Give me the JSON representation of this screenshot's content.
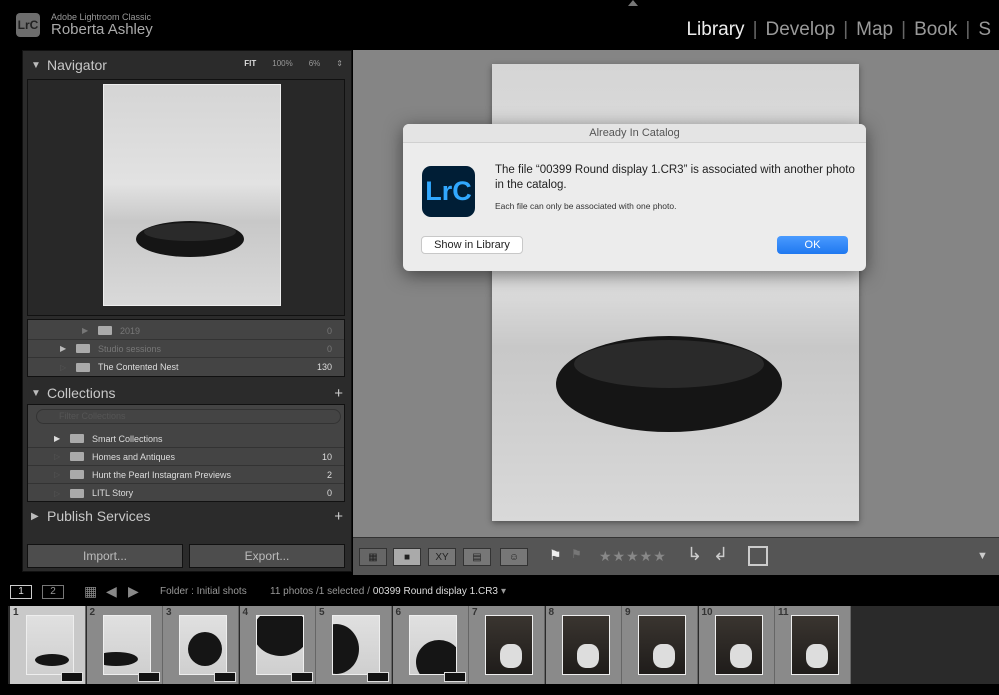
{
  "header": {
    "logo": "LrC",
    "app_name": "Adobe Lightroom Classic",
    "user_name": "Roberta Ashley",
    "modules": [
      "Library",
      "Develop",
      "Map",
      "Book",
      "S"
    ],
    "active_module": "Library"
  },
  "navigator": {
    "title": "Navigator",
    "fit": "FIT",
    "zoom_100": "100%",
    "zoom_custom": "6%"
  },
  "folders": [
    {
      "name": "2019",
      "count": "0"
    },
    {
      "name": "Studio sessions",
      "count": "0"
    },
    {
      "name": "The Contented Nest",
      "count": "130"
    }
  ],
  "collections": {
    "title": "Collections",
    "filter_placeholder": "Filter Collections",
    "items": [
      {
        "name": "Smart Collections",
        "count": ""
      },
      {
        "name": "Homes and Antiques",
        "count": "10"
      },
      {
        "name": "Hunt the Pearl Instagram Previews",
        "count": "2"
      },
      {
        "name": "LITL Story",
        "count": "0"
      }
    ]
  },
  "publish": {
    "title": "Publish Services"
  },
  "buttons": {
    "import": "Import...",
    "export": "Export..."
  },
  "dialog": {
    "title": "Already In Catalog",
    "icon": "LrC",
    "message": "The file “00399 Round display 1.CR3” is associated with another photo in the catalog.",
    "sub": "Each file can only be associated with one photo.",
    "show_in_library": "Show in Library",
    "ok": "OK",
    "accent": "#1f78f0"
  },
  "toolbar": {
    "compare_label": "XY",
    "rating_stars": "★★★★★"
  },
  "filmstrip": {
    "view1": "1",
    "view2": "2",
    "source": "Folder : Initial shots",
    "count": "11 photos /1 selected /",
    "filename": "00399 Round display 1.CR3",
    "thumbnails": [
      "1",
      "2",
      "3",
      "4",
      "5",
      "6",
      "7",
      "8",
      "9",
      "10",
      "11"
    ],
    "selected_index": 0
  }
}
